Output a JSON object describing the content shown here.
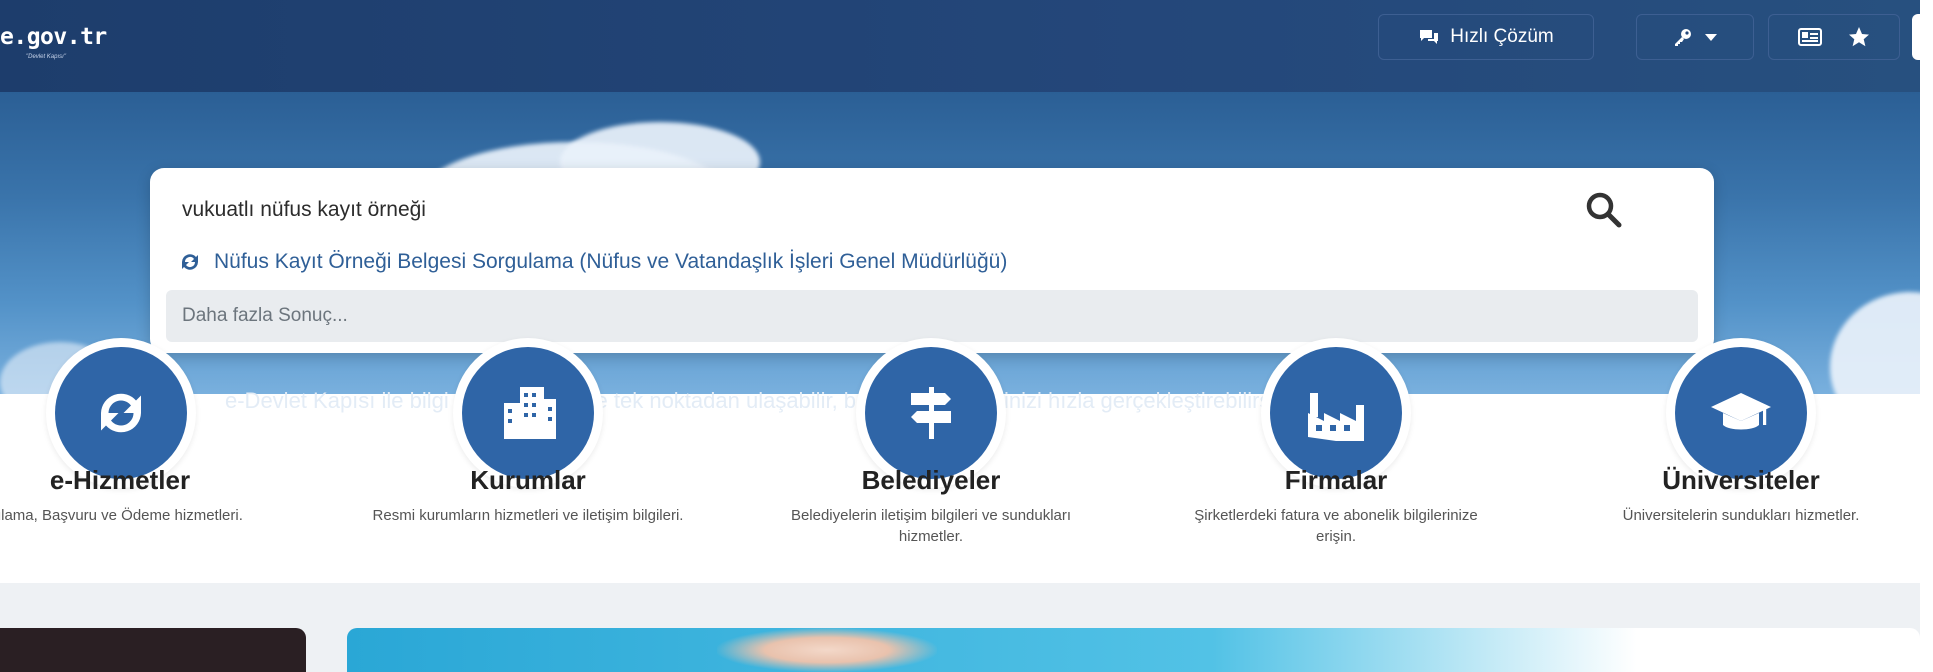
{
  "header": {
    "logo_text": "e.gov.tr",
    "logo_subtext": "\"Devlet Kapısı\"",
    "quick_solution_label": "Hızlı Çözüm"
  },
  "search": {
    "query": "vukuatlı nüfus kayıt örneği",
    "suggestion": "Nüfus Kayıt Örneği Belgesi Sorgulama (Nüfus ve Vatandaşlık İşleri Genel Müdürlüğü)",
    "more_results": "Daha fazla Sonuç..."
  },
  "tagline": "e-Devlet Kapısı ile bilgi ve belgelerinize tek noktadan ulaşabilir, başvuru işlemlerinizi hızla gerçekleştirebilirsiniz",
  "categories": [
    {
      "title": "e-Hizmetler",
      "desc": "Sorgulama, Başvuru ve Ödeme hizmetleri.",
      "icon": "refresh-icon"
    },
    {
      "title": "Kurumlar",
      "desc": "Resmi kurumların hizmetleri ve iletişim bilgileri.",
      "icon": "building-icon"
    },
    {
      "title": "Belediyeler",
      "desc": "Belediyelerin iletişim bilgileri ve sundukları hizmetler.",
      "icon": "signpost-icon"
    },
    {
      "title": "Firmalar",
      "desc": "Şirketlerdeki fatura ve abonelik bilgilerinize erişin.",
      "icon": "factory-icon"
    },
    {
      "title": "Üniversiteler",
      "desc": "Üniversitelerin sundukları hizmetler.",
      "icon": "graduation-cap-icon"
    }
  ],
  "colors": {
    "header_bg": "#1d3d6c",
    "accent": "#2f65a7",
    "link": "#2f5f97"
  }
}
